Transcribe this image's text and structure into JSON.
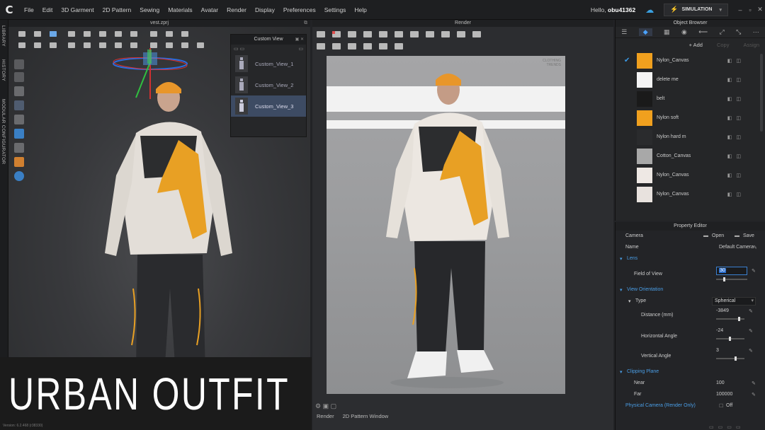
{
  "app": {
    "logo": "C",
    "menu": [
      "File",
      "Edit",
      "3D Garment",
      "2D Pattern",
      "Sewing",
      "Materials",
      "Avatar",
      "Render",
      "Display",
      "Preferences",
      "Settings",
      "Help"
    ],
    "hello_prefix": "Hello,",
    "username": "obu41362",
    "mode": "SIMULATION"
  },
  "side_tabs": [
    "LIBRARY",
    "HISTORY",
    "MODULAR CONFIGURATOR"
  ],
  "viewport3d": {
    "title": "vest.zprj"
  },
  "custom_view": {
    "title": "Custom View",
    "items": [
      "Custom_View_1",
      "Custom_View_2",
      "Custom_View_3"
    ],
    "selected_index": 2
  },
  "render": {
    "title": "Render",
    "watermark": "CLOTHING TRENDS",
    "tabs": [
      "Render",
      "2D Pattern Window"
    ]
  },
  "object_browser": {
    "title": "Object Browser",
    "toolbar": {
      "add": "+ Add",
      "copy": "Copy",
      "assign": "Assign"
    },
    "fabrics": [
      {
        "name": "Nylon_Canvas",
        "color": "#f0a01e",
        "checked": true
      },
      {
        "name": "delete me",
        "color": "#f4f4f4",
        "checked": false
      },
      {
        "name": "belt",
        "color": "#1a1a1a",
        "checked": false
      },
      {
        "name": "Nylon soft",
        "color": "#f0a01e",
        "checked": false
      },
      {
        "name": "Nylon hard m",
        "color": "#2a2b2d",
        "checked": false
      },
      {
        "name": "Cotton_Canvas",
        "color": "#a8a8a8",
        "checked": false
      },
      {
        "name": "Nylon_Canvas",
        "color": "#eee8e4",
        "checked": false
      },
      {
        "name": "Nylon_Canvas",
        "color": "#e8e2de",
        "checked": false
      }
    ]
  },
  "property_editor": {
    "title": "Property Editor",
    "camera_label": "Camera",
    "open": "Open",
    "save": "Save",
    "name_label": "Name",
    "name_value": "Default Camera",
    "lens_section": "Lens",
    "fov_label": "Field of View",
    "fov_value": "30",
    "view_orientation": "View Orientation",
    "type_label": "Type",
    "type_value": "Spherical",
    "distance_label": "Distance (mm)",
    "distance_value": "-3849",
    "h_angle_label": "Horizontal Angle",
    "h_angle_value": "-24",
    "v_angle_label": "Vertical Angle",
    "v_angle_value": "3",
    "clipping_section": "Clipping Plane",
    "near_label": "Near",
    "near_value": "100",
    "far_label": "Far",
    "far_value": "100000",
    "physical_label": "Physical Camera (Render Only)",
    "physical_value": "Off"
  },
  "overlay": {
    "title": "URBAN OUTFIT"
  },
  "version": "Version: 6.2.468 (r38330)",
  "colors": {
    "accent": "#3a9ae6",
    "orange": "#f0a01e",
    "panel": "#252628"
  }
}
